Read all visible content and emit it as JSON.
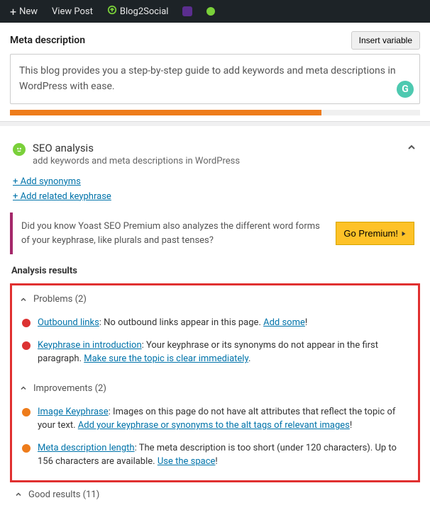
{
  "topbar": {
    "new": "New",
    "view_post": "View Post",
    "blog2social": "Blog2Social"
  },
  "meta": {
    "heading": "Meta description",
    "insert_variable": "Insert variable",
    "text": "This blog provides you a step-by-step guide to add keywords and meta descriptions in WordPress with ease.",
    "progress_pct": 76
  },
  "seo": {
    "title": "SEO analysis",
    "subtitle": "add keywords and meta descriptions in WordPress",
    "add_synonyms": "+ Add synonyms",
    "add_related": "+ Add related keyphrase"
  },
  "premium": {
    "text": "Did you know Yoast SEO Premium also analyzes the different word forms of your keyphrase, like plurals and past tenses?",
    "cta": "Go Premium!"
  },
  "analysis": {
    "heading": "Analysis results",
    "problems_label": "Problems (2)",
    "improvements_label": "Improvements (2)",
    "good_label": "Good results (11)"
  },
  "problems": [
    {
      "link": "Outbound links",
      "text": ": No outbound links appear in this page. ",
      "link2": "Add some",
      "tail": "!"
    },
    {
      "link": "Keyphrase in introduction",
      "text": ": Your keyphrase or its synonyms do not appear in the first paragraph. ",
      "link2": "Make sure the topic is clear immediately",
      "tail": "."
    }
  ],
  "improvements": [
    {
      "link": "Image Keyphrase",
      "text": ": Images on this page do not have alt attributes that reflect the topic of your text. ",
      "link2": "Add your keyphrase or synonyms to the alt tags of relevant images",
      "tail": "!"
    },
    {
      "link": "Meta description length",
      "text": ": The meta description is too short (under 120 characters). Up to 156 characters are available. ",
      "link2": "Use the space",
      "tail": "!"
    }
  ]
}
